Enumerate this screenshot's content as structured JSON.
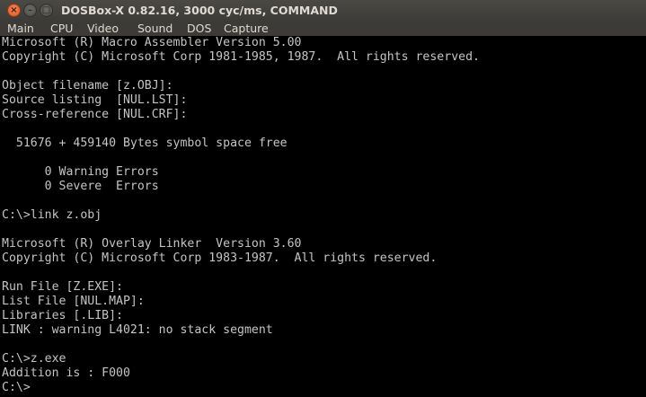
{
  "window": {
    "title": "DOSBox-X 0.82.16, 3000 cyc/ms, COMMAND"
  },
  "menubar": {
    "items": [
      "Main",
      "CPU",
      "Video",
      "Sound",
      "DOS",
      "Capture"
    ]
  },
  "console": {
    "lines": [
      "Microsoft (R) Macro Assembler Version 5.00",
      "Copyright (C) Microsoft Corp 1981-1985, 1987.  All rights reserved.",
      "",
      "Object filename [z.OBJ]:",
      "Source listing  [NUL.LST]:",
      "Cross-reference [NUL.CRF]:",
      "",
      "  51676 + 459140 Bytes symbol space free",
      "",
      "      0 Warning Errors",
      "      0 Severe  Errors",
      "",
      "C:\\>link z.obj",
      "",
      "Microsoft (R) Overlay Linker  Version 3.60",
      "Copyright (C) Microsoft Corp 1983-1987.  All rights reserved.",
      "",
      "Run File [Z.EXE]:",
      "List File [NUL.MAP]:",
      "Libraries [.LIB]:",
      "LINK : warning L4021: no stack segment",
      "",
      "C:\\>z.exe",
      "Addition is : F000",
      "C:\\>"
    ]
  },
  "colors": {
    "console_text": "#c4c4c4",
    "console_bg": "#000000",
    "titlebar_bg": "#3c3b37",
    "close_button": "#e8602c"
  }
}
